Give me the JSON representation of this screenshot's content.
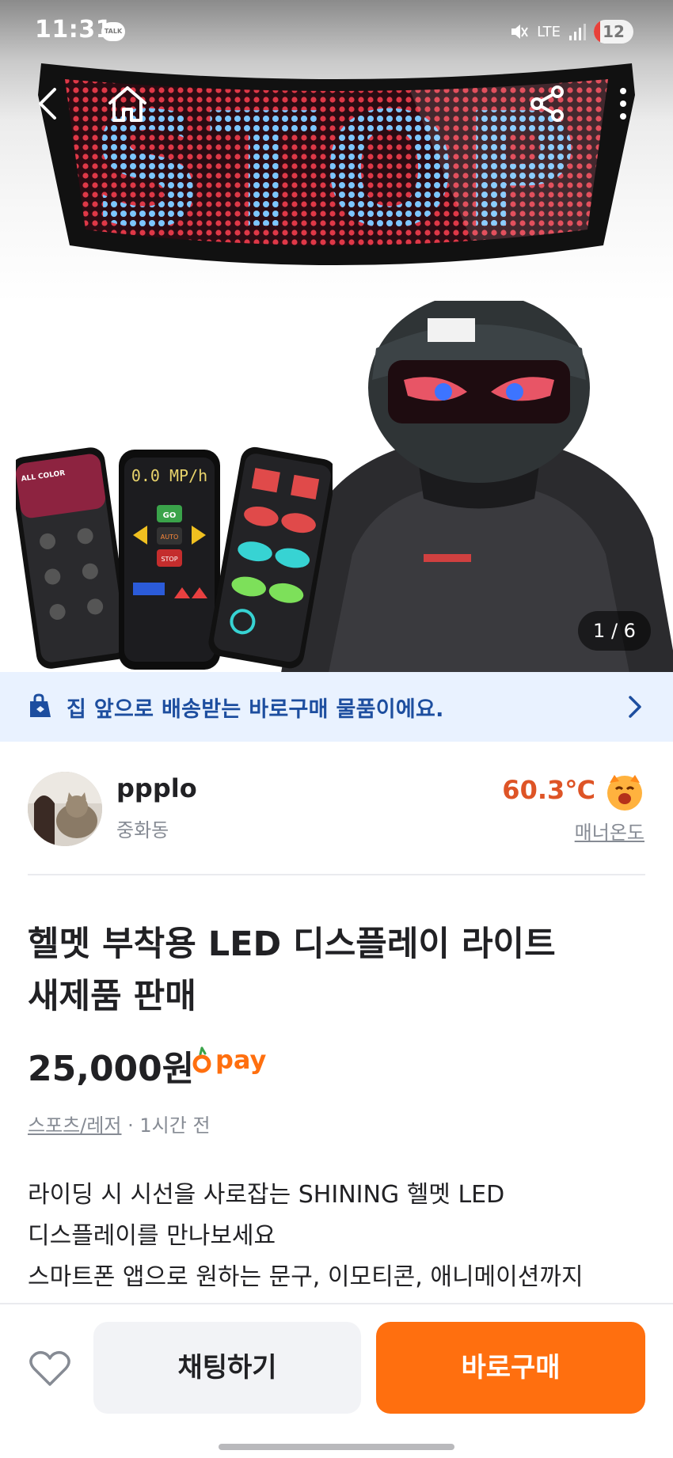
{
  "status_bar": {
    "time": "11:31",
    "talk_badge": "TALK",
    "network": "LTE",
    "battery": "12"
  },
  "gallery": {
    "counter": "1 / 6",
    "visor_text": "STOP",
    "phone_speed": "0.0 MP/h",
    "phone_app_label": "ALL COLOR",
    "phone_go": "GO",
    "phone_auto": "AUTO",
    "phone_stop": "STOP"
  },
  "banner": {
    "text": "집 앞으로 배송받는 바로구매 물품이에요."
  },
  "seller": {
    "name": "ppplo",
    "location": "중화동",
    "temperature": "60.3℃",
    "temperature_label": "매너온도"
  },
  "product": {
    "title_line1": "헬멧 부착용 LED 디스플레이 라이트",
    "title_line2": "새제품 판매",
    "price": "25,000원",
    "pay_label": "pay",
    "category": "스포츠/레저",
    "separator": " · ",
    "posted": "1시간 전",
    "description_lines": [
      "라이딩 시 시선을 사로잡는 SHINING 헬멧 LED",
      "디스플레이를 만나보세요",
      "스마트폰 앱으로 원하는 문구, 이모티콘, 애니메이션까지"
    ]
  },
  "actions": {
    "chat": "채팅하기",
    "buy": "바로구매"
  },
  "colors": {
    "accent": "#ff6f0f",
    "temperature": "#de5426",
    "banner_bg": "#e9f2ff",
    "banner_text": "#1d4e9f"
  },
  "icons": {
    "back": "back-arrow-icon",
    "home": "home-icon",
    "share": "share-icon",
    "more": "more-vertical-icon",
    "banner": "delivery-bag-icon",
    "like": "heart-icon"
  }
}
